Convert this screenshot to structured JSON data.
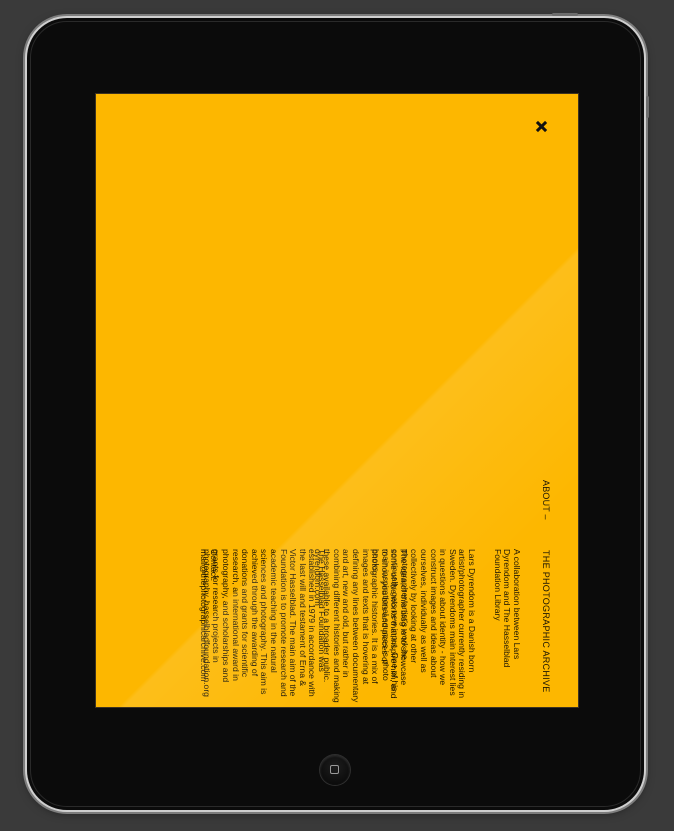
{
  "screen": {
    "background": "#fdb700",
    "close_icon": "close-icon",
    "nav": {
      "about": "ABOUT –"
    },
    "site_title": "THE PHOTOGRAPHIC ARCHIVE",
    "intro": "A collaboration between Lars Dyrendom and The Hasselblad Foundation Library",
    "bio": "Lars Dyrendom is a Danish born artist/photographer currently residing in Sweden. Dyrendoms main interest lies in questions about identity - how we construct images and ideas about ourselves, individually as well as collectively by looking at other photographer/artist's work he continually gets new input. One of his main inspirational sources is photo books.",
    "work": "The idea of this blog is to showcase some of the works that inspire him, and to show you bits and pieces of photographic histories. It is a mix of images and texts that is hovering at defining any lines between documentary and art, new and old, but rather in combining different histories and making these available to a broader public. dyrendom.com",
    "foundation": "The Hasselblad Foundation was established in 1979 in accordance with the last will and testament of Erna & Victor Hasselblad. The main aim of the Foundation is to promote research and academic teaching in the natural sciences and photography. This aim is achieved through the awarding of donations and grants for scientific research, an international award in photography, and scholarships and grants for research projects in photography. hasselbladfoundation.org",
    "contact": "Contact: mail@thephotographicarchive.com"
  },
  "device": {
    "home_icon": "home-button-icon",
    "bezel_color": "#0b0b0b"
  }
}
